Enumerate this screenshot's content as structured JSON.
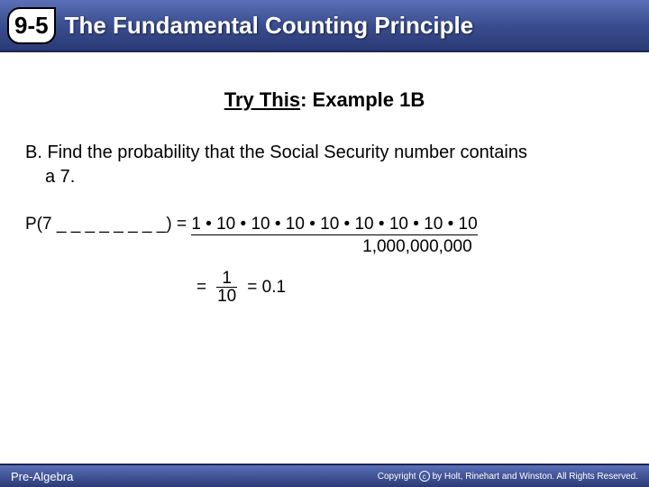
{
  "header": {
    "lesson_number": "9-5",
    "title": "The Fundamental Counting Principle"
  },
  "section": {
    "label_underlined": "Try This",
    "label_rest": ": Example 1B"
  },
  "problem": {
    "line1": "B. Find the probability that the Social Security number contains",
    "line2": "a 7."
  },
  "equation": {
    "lhs": "P(7 _ _ _ _ _ _ _ _) = ",
    "numerator_expr": "1 • 10 • 10 • 10 • 10 • 10 • 10 • 10 • 10",
    "denom_value": "1,000,000,000",
    "frac_eq_prefix": "= ",
    "frac_num": "1",
    "frac_den": "10",
    "frac_eq_suffix": " = 0.1"
  },
  "footer": {
    "left": "Pre-Algebra",
    "right_prefix": "Copyright",
    "right_rest": "by Holt, Rinehart and Winston. All Rights Reserved."
  }
}
